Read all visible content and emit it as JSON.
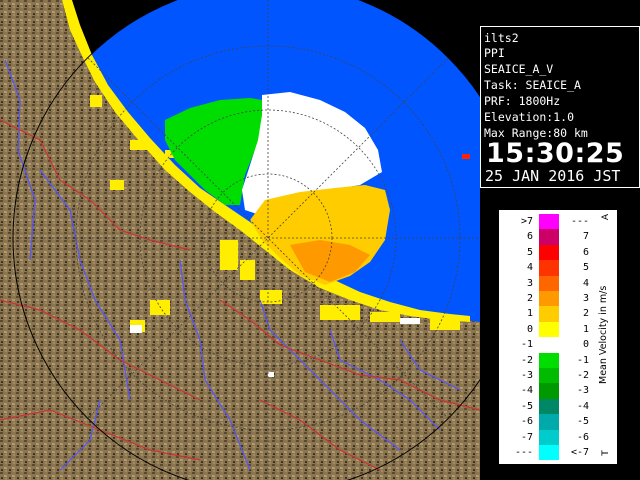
{
  "info": {
    "station": "ilts2",
    "product": "PPI",
    "moment": "SEAICE_A_V",
    "task": "Task: SEAICE_A",
    "prf": "PRF: 1800Hz",
    "elevation": "Elevation:1.0",
    "max_range": "Max Range:80 km",
    "time": "15:30:25",
    "date": "25 JAN 2016 JST"
  },
  "legend": {
    "title": "Mean Velocity in m/s",
    "corner_top": "A",
    "corner_bottom": "T",
    "rows": [
      {
        "lo": ">7",
        "hi": "---",
        "color": "#ff00ff"
      },
      {
        "lo": "6",
        "hi": "7",
        "color": "#cc0066"
      },
      {
        "lo": "5",
        "hi": "6",
        "color": "#ff0000"
      },
      {
        "lo": "4",
        "hi": "5",
        "color": "#ff3300"
      },
      {
        "lo": "3",
        "hi": "4",
        "color": "#ff6600"
      },
      {
        "lo": "2",
        "hi": "3",
        "color": "#ff9900"
      },
      {
        "lo": "1",
        "hi": "2",
        "color": "#ffcc00"
      },
      {
        "lo": "0",
        "hi": "1",
        "color": "#ffff00"
      },
      {
        "lo": "-1",
        "hi": "0",
        "color": "#ffffff"
      },
      {
        "lo": "-2",
        "hi": "-1",
        "color": "#00dd00"
      },
      {
        "lo": "-3",
        "hi": "-2",
        "color": "#00bb00"
      },
      {
        "lo": "-4",
        "hi": "-3",
        "color": "#009900"
      },
      {
        "lo": "-5",
        "hi": "-4",
        "color": "#008866"
      },
      {
        "lo": "-6",
        "hi": "-5",
        "color": "#00aaaa"
      },
      {
        "lo": "-7",
        "hi": "-6",
        "color": "#00cccc"
      },
      {
        "lo": "---",
        "hi": "<-7",
        "color": "#00ffff"
      }
    ]
  },
  "colors": {
    "sea": "#0055ff",
    "outside": "#000000",
    "terrain": "#8a7550",
    "rivers": "#5555ff",
    "borders": "#cc3333"
  }
}
